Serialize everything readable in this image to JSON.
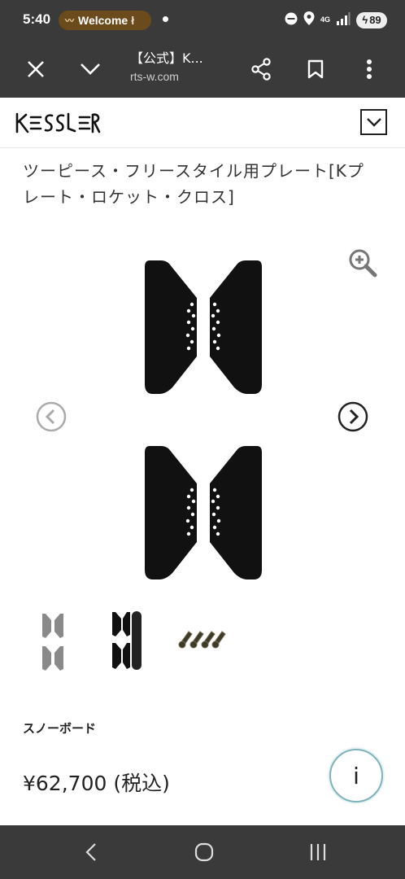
{
  "status_bar": {
    "time": "5:40",
    "notification": "Welcome",
    "notification_suffix": "ł",
    "network": "4G",
    "battery": "89"
  },
  "browser": {
    "page_title": "【公式】K...",
    "url": "rts-w.com"
  },
  "site": {
    "logo_text": "KESSLER"
  },
  "product": {
    "title": "ツーピース・フリースタイル用プレート[Kプレート・ロケット・クロス]",
    "category": "スノーボード",
    "price": "¥62,700 (税込)"
  },
  "info_button": {
    "label": "i"
  },
  "colors": {
    "system_bar": "#3a3a3a",
    "info_ring": "#7fb3b9",
    "plate": "#111111"
  }
}
